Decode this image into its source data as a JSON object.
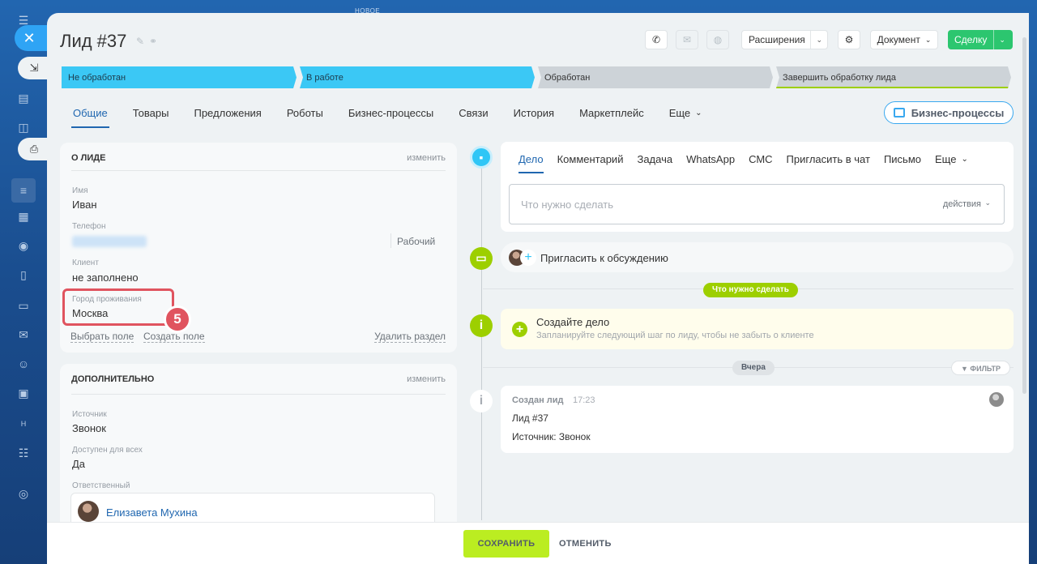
{
  "background": {
    "new_label": "НОВОЕ"
  },
  "title": "Лид #37",
  "header": {
    "extensions": "Расширения",
    "document": "Документ",
    "deal": "Сделку"
  },
  "stages": [
    "Не обработан",
    "В работе",
    "Обработан",
    "Завершить обработку лида"
  ],
  "tabs": [
    "Общие",
    "Товары",
    "Предложения",
    "Роботы",
    "Бизнес-процессы",
    "Связи",
    "История",
    "Маркетплейс",
    "Еще"
  ],
  "bp_button": "Бизнес-процессы",
  "about": {
    "header": "О ЛИДЕ",
    "edit": "изменить",
    "name_label": "Имя",
    "name_value": "Иван",
    "phone_label": "Телефон",
    "phone_type": "Рабочий",
    "client_label": "Клиент",
    "client_value": "не заполнено",
    "city_label": "Город проживания",
    "city_value": "Москва",
    "choose_field": "Выбрать поле",
    "create_field": "Создать поле",
    "delete_section": "Удалить раздел",
    "badge": "5"
  },
  "extra": {
    "header": "ДОПОЛНИТЕЛЬНО",
    "edit": "изменить",
    "source_label": "Источник",
    "source_value": "Звонок",
    "available_label": "Доступен для всех",
    "available_value": "Да",
    "responsible_label": "Ответственный",
    "responsible_value": "Елизавета Мухина"
  },
  "activity": {
    "tabs": [
      "Дело",
      "Комментарий",
      "Задача",
      "WhatsApp",
      "СМС",
      "Пригласить в чат",
      "Письмо",
      "Еще"
    ],
    "placeholder": "Что нужно сделать",
    "actions": "действия",
    "invite": "Пригласить к обсуждению",
    "todo_pill": "Что нужно сделать",
    "create_title": "Создайте дело",
    "create_sub": "Запланируйте следующий шаг по лиду, чтобы не забыть о клиенте",
    "yesterday": "Вчера",
    "filter": "ФИЛЬТР",
    "created_title": "Создан лид",
    "created_time": "17:23",
    "created_line1": "Лид #37",
    "created_line2": "Источник: Звонок"
  },
  "footer": {
    "save": "СОХРАНИТЬ",
    "cancel": "ОТМЕНИТЬ"
  },
  "colors": {
    "accent": "#2067b0",
    "stage_blue": "#3bc8f5",
    "save": "#bbed21",
    "deal": "#2cc66f",
    "highlight": "#e0545f"
  }
}
